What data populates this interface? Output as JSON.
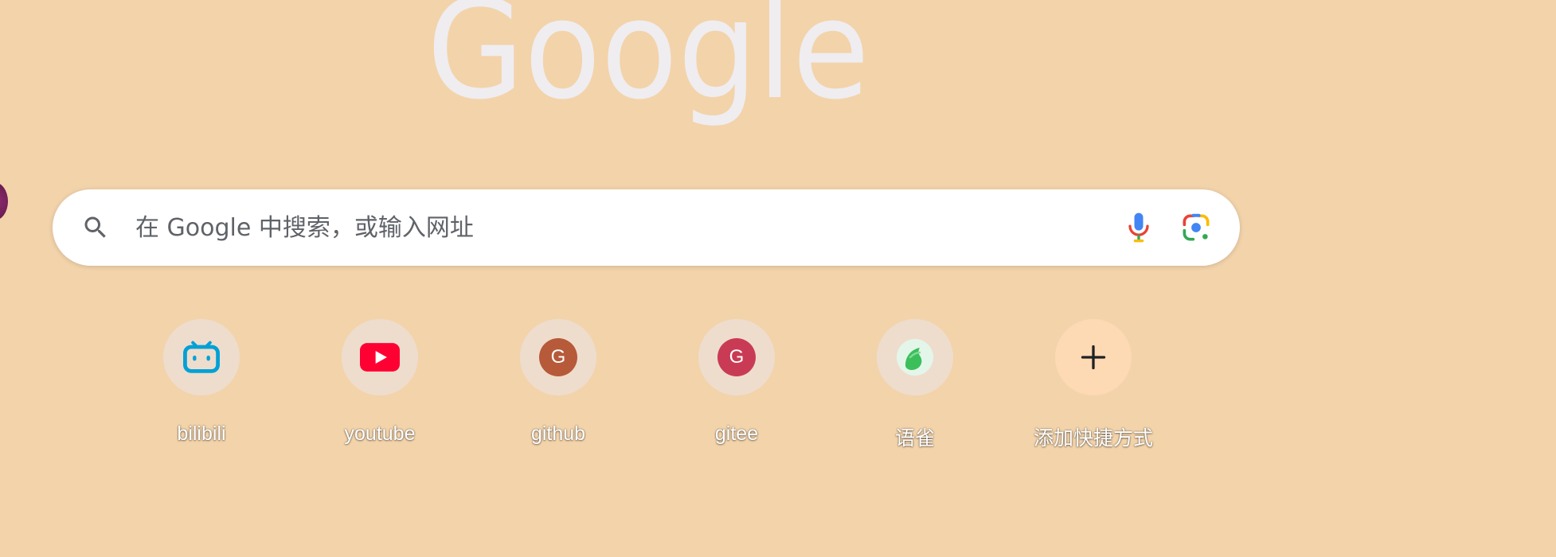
{
  "logo": {
    "text": "Google"
  },
  "search": {
    "placeholder": "在 Google 中搜索，或输入网址",
    "value": "",
    "icons": [
      "search-icon",
      "microphone-icon",
      "google-lens-icon"
    ]
  },
  "shortcuts": [
    {
      "label": "bilibili",
      "icon": "bilibili-icon"
    },
    {
      "label": "youtube",
      "icon": "youtube-icon"
    },
    {
      "label": "github",
      "icon": "letter-g-icon",
      "letter": "G",
      "color": "#b65a3a"
    },
    {
      "label": "gitee",
      "icon": "letter-g-icon",
      "letter": "G",
      "color": "#c93b54"
    },
    {
      "label": "语雀",
      "icon": "yuque-icon"
    },
    {
      "label": "添加快捷方式",
      "icon": "plus-icon"
    }
  ],
  "colors": {
    "background": "#f3d3aa",
    "tile": "#eeddcd",
    "add_tile": "#fdd9b4",
    "logo": "#efedf0"
  }
}
